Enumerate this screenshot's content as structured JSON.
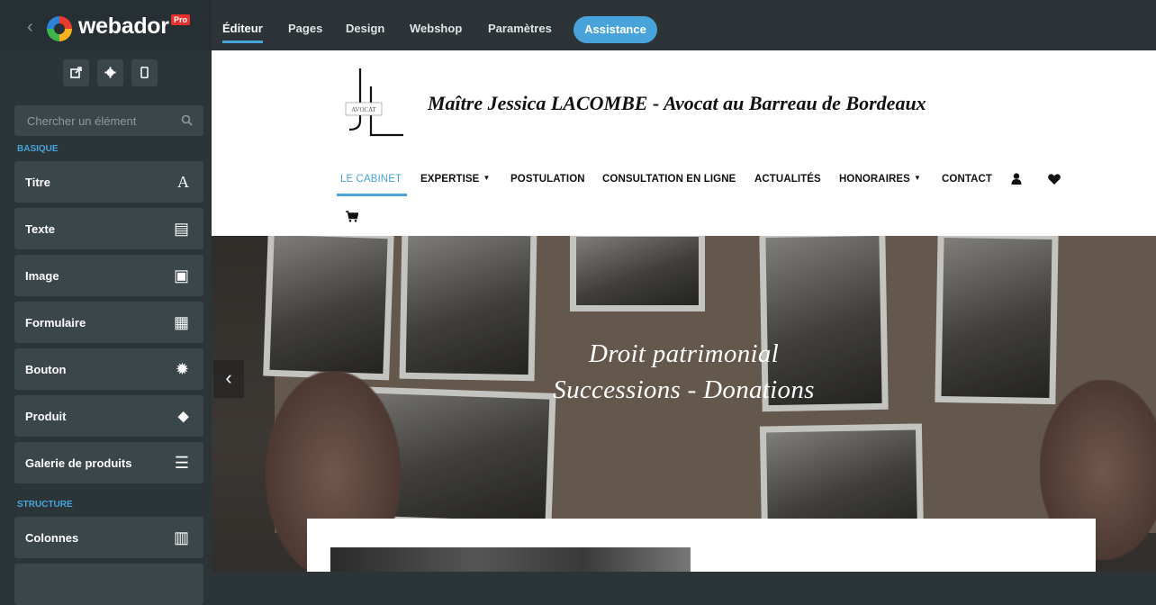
{
  "app": {
    "back_icon": "chevron-left-icon",
    "logo_text": "webador",
    "pro_badge": "Pro",
    "tabs": [
      {
        "label": "Éditeur"
      },
      {
        "label": "Pages"
      },
      {
        "label": "Design"
      },
      {
        "label": "Webshop"
      },
      {
        "label": "Paramètres"
      }
    ],
    "assist_label": "Assistance",
    "accent_color": "#47a3d9"
  },
  "sidebar": {
    "tools": [
      "external-link-icon",
      "gear-icon",
      "mobile-icon"
    ],
    "search_placeholder": "Chercher un élément",
    "sections": [
      {
        "title": "BASIQUE"
      },
      {
        "title": "STRUCTURE"
      }
    ],
    "items": [
      {
        "label": "Titre",
        "icon": "A"
      },
      {
        "label": "Texte",
        "icon": "▤"
      },
      {
        "label": "Image",
        "icon": "▣"
      },
      {
        "label": "Formulaire",
        "icon": "▦"
      },
      {
        "label": "Bouton",
        "icon": "✹"
      },
      {
        "label": "Produit",
        "icon": "⬥"
      },
      {
        "label": "Galerie de produits",
        "icon": "☰"
      },
      {
        "label": "Colonnes",
        "icon": "▥"
      }
    ]
  },
  "site": {
    "logo_caption": "AVOCAT",
    "title": "Maître Jessica LACOMBE - Avocat au Barreau de Bordeaux",
    "nav": [
      {
        "label": "LE CABINET"
      },
      {
        "label": "EXPERTISE"
      },
      {
        "label": "POSTULATION"
      },
      {
        "label": "CONSULTATION EN LIGNE"
      },
      {
        "label": "ACTUALITÉS"
      },
      {
        "label": "HONORAIRES"
      },
      {
        "label": "CONTACT"
      }
    ],
    "hero": {
      "line1": "Droit patrimonial",
      "line2": "Successions - Donations"
    }
  }
}
